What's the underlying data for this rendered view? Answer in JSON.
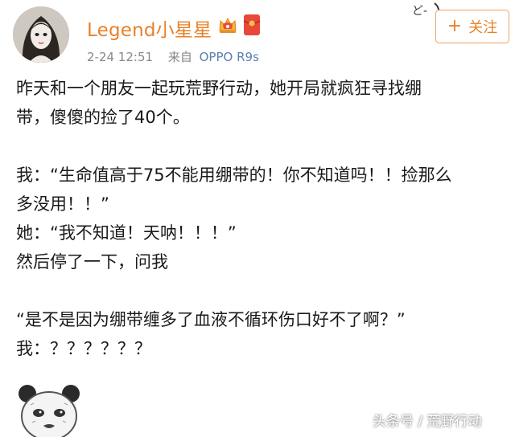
{
  "header": {
    "username": "Legend小星星",
    "time": "2-24 12:51",
    "from_label": "来自",
    "device": "OPPO R9s",
    "badges": [
      "crown-badge-icon",
      "red-packet-icon"
    ],
    "follow_label": "关注",
    "follow_icon": "plus-icon"
  },
  "post": {
    "lines": [
      "昨天和一个朋友一起玩荒野行动，她开局就疯狂寻找绷",
      "带，傻傻的捡了40个。",
      "",
      "我：“生命值高于75不能用绷带的！你不知道吗！！捡那么",
      "多没用！！”",
      "她：“我不知道！天呐！！！”",
      "然后停了一下，问我",
      "",
      "“是不是因为绷带缠多了血液不循环伤口好不了啊？”",
      "我：？？？？？？"
    ]
  },
  "watermark": "头条号 / 荒野行动",
  "colors": {
    "accent": "#e8812a",
    "device_link": "#5b7fb3",
    "meta_gray": "#888888",
    "text": "#1a1a1a"
  }
}
